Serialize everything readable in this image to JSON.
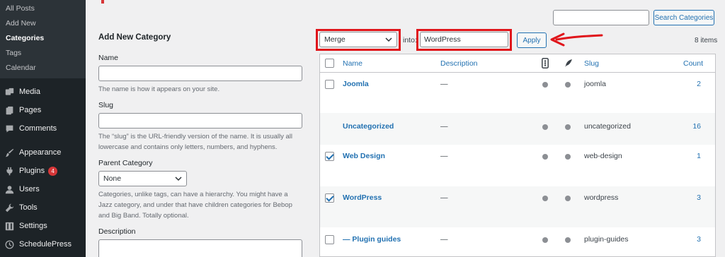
{
  "sidebar": {
    "submenu": [
      "All Posts",
      "Add New",
      "Categories",
      "Tags",
      "Calendar"
    ],
    "menu": [
      {
        "label": "Media",
        "icon": "media-icon"
      },
      {
        "label": "Pages",
        "icon": "pages-icon"
      },
      {
        "label": "Comments",
        "icon": "comments-icon"
      },
      {
        "label": "Appearance",
        "icon": "appearance-icon"
      },
      {
        "label": "Plugins",
        "icon": "plugins-icon",
        "badge": "4"
      },
      {
        "label": "Users",
        "icon": "users-icon"
      },
      {
        "label": "Tools",
        "icon": "tools-icon"
      },
      {
        "label": "Settings",
        "icon": "settings-icon"
      },
      {
        "label": "SchedulePress",
        "icon": "schedulepress-icon"
      }
    ]
  },
  "search": {
    "button_label": "Search Categories"
  },
  "form": {
    "title": "Add New Category",
    "name_label": "Name",
    "name_help": "The name is how it appears on your site.",
    "slug_label": "Slug",
    "slug_help_1": "The “slug” is the URL-friendly version of the name. It is usually all",
    "slug_help_2": "lowercase and contains only letters, numbers, and hyphens.",
    "parent_label": "Parent Category",
    "parent_value": "None",
    "parent_help_1": "Categories, unlike tags, can have a hierarchy. You might have a",
    "parent_help_2": "Jazz category, and under that have children categories for Bebop",
    "parent_help_3": "and Big Band. Totally optional.",
    "description_label": "Description"
  },
  "bulk": {
    "action_value": "Merge",
    "into_label": "into:",
    "into_value": "WordPress",
    "apply_label": "Apply",
    "items_count": "8 items"
  },
  "table": {
    "headers": {
      "name": "Name",
      "description": "Description",
      "slug": "Slug",
      "count": "Count"
    },
    "rows": [
      {
        "name": "Joomla",
        "description": "—",
        "slug": "joomla",
        "count": "2",
        "checked": false,
        "has_checkbox": true
      },
      {
        "name": "Uncategorized",
        "description": "—",
        "slug": "uncategorized",
        "count": "16",
        "checked": false,
        "has_checkbox": false
      },
      {
        "name": "Web Design",
        "description": "—",
        "slug": "web-design",
        "count": "1",
        "checked": true,
        "has_checkbox": true
      },
      {
        "name": "WordPress",
        "description": "—",
        "slug": "wordpress",
        "count": "3",
        "checked": true,
        "has_checkbox": true
      },
      {
        "name": "— Plugin guides",
        "description": "—",
        "slug": "plugin-guides",
        "count": "3",
        "checked": false,
        "has_checkbox": true
      }
    ]
  },
  "colors": {
    "accent": "#2271b1",
    "highlight": "#e0151b",
    "sidebar": "#1d2327"
  }
}
